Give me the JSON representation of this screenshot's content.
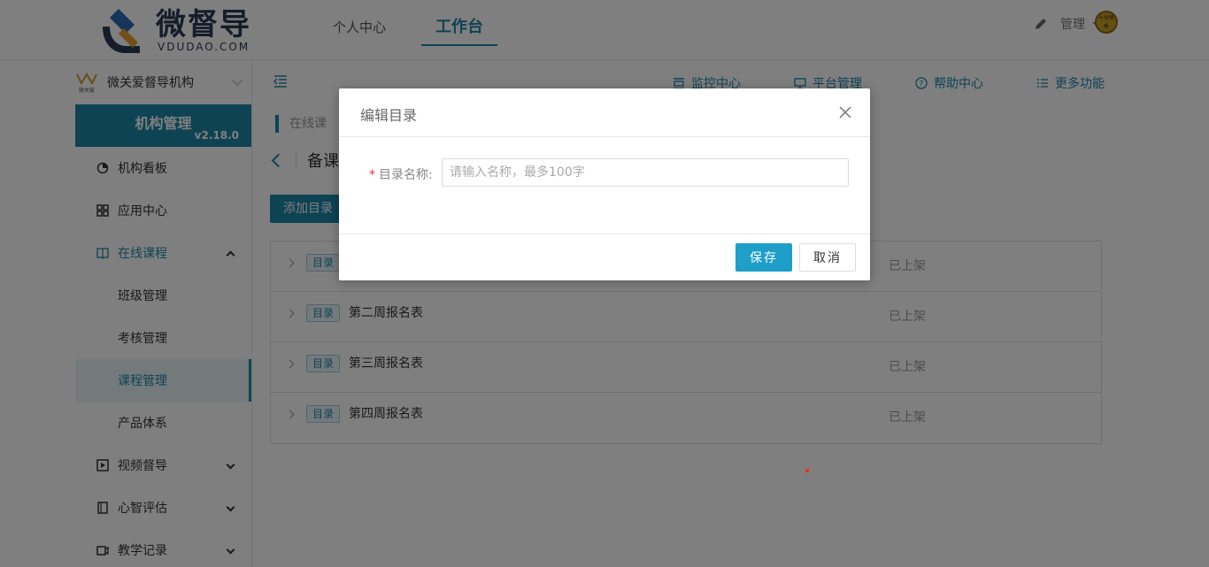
{
  "header": {
    "brand": "微督导",
    "brand_sub": "VDUDAO.COM",
    "tabs": [
      {
        "label": "个人中心",
        "active": false
      },
      {
        "label": "工作台",
        "active": true
      }
    ],
    "user_name": "管理",
    "avatar_text": "十分优秀"
  },
  "sidebar": {
    "org_name": "微关爱督导机构",
    "org_logo_text": "微关爱",
    "banner_title": "机构管理",
    "version": "v2.18.0",
    "items": [
      {
        "label": "机构看板"
      },
      {
        "label": "应用中心"
      },
      {
        "label": "在线课程"
      },
      {
        "label": "班级管理"
      },
      {
        "label": "考核管理"
      },
      {
        "label": "课程管理"
      },
      {
        "label": "产品体系"
      },
      {
        "label": "视频督导"
      },
      {
        "label": "心智评估"
      },
      {
        "label": "教学记录"
      }
    ]
  },
  "toolbar": {
    "items": [
      {
        "label": "监控中心"
      },
      {
        "label": "平台管理"
      },
      {
        "label": "帮助中心"
      },
      {
        "label": "更多功能"
      }
    ]
  },
  "main": {
    "breadcrumb": "在线课",
    "page_title": "备课",
    "add_button": "添加目录",
    "rows": [
      {
        "tag": "目录",
        "name": "",
        "status": "已上架"
      },
      {
        "tag": "目录",
        "name": "第二周报名表",
        "status": "已上架"
      },
      {
        "tag": "目录",
        "name": "第三周报名表",
        "status": "已上架"
      },
      {
        "tag": "目录",
        "name": "第四周报名表",
        "status": "已上架"
      }
    ]
  },
  "dialog": {
    "title": "编辑目录",
    "field_label": "目录名称:",
    "required_mark": "*",
    "placeholder": "请输入名称，最多100字",
    "value": "",
    "save_label": "保存",
    "cancel_label": "取消"
  },
  "colors": {
    "accent": "#1d86a8",
    "save_button": "#1d9fc9"
  }
}
